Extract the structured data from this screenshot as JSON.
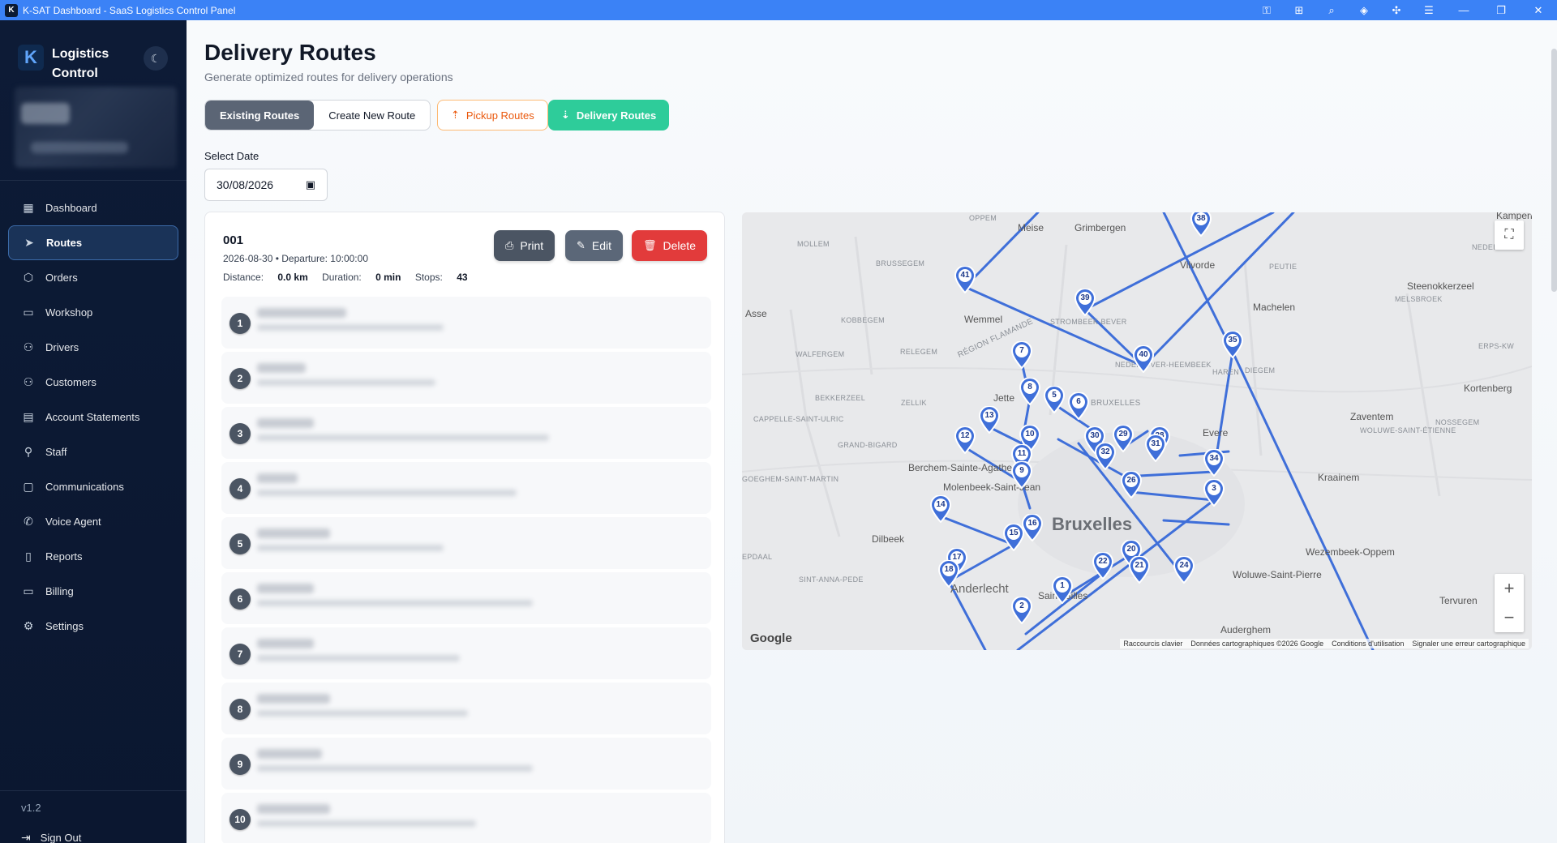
{
  "window": {
    "title": "K-SAT Dashboard - SaaS Logistics Control Panel",
    "logo_letter": "K"
  },
  "brand": {
    "name": "Logistics Control",
    "logo_letter": "K"
  },
  "nav": {
    "items": [
      {
        "label": "Dashboard",
        "icon": "grid-icon"
      },
      {
        "label": "Routes",
        "icon": "navigation-icon",
        "active": true
      },
      {
        "label": "Orders",
        "icon": "box-icon"
      },
      {
        "label": "Workshop",
        "icon": "briefcase-icon"
      },
      {
        "label": "Drivers",
        "icon": "users-icon"
      },
      {
        "label": "Customers",
        "icon": "users-icon"
      },
      {
        "label": "Account Statements",
        "icon": "file-text-icon"
      },
      {
        "label": "Staff",
        "icon": "user-key-icon"
      },
      {
        "label": "Communications",
        "icon": "message-square-icon"
      },
      {
        "label": "Voice Agent",
        "icon": "phone-icon"
      },
      {
        "label": "Reports",
        "icon": "file-icon"
      },
      {
        "label": "Billing",
        "icon": "credit-card-icon"
      },
      {
        "label": "Settings",
        "icon": "gear-icon"
      }
    ]
  },
  "version": "v1.2",
  "signout_label": "Sign Out",
  "page": {
    "title": "Delivery Routes",
    "subtitle": "Generate optimized routes for delivery operations"
  },
  "tabs": {
    "existing": "Existing Routes",
    "create": "Create New Route"
  },
  "buttons": {
    "pickup": "Pickup Routes",
    "delivery": "Delivery Routes"
  },
  "date": {
    "label": "Select Date",
    "value": "30/08/2026"
  },
  "route": {
    "name": "001",
    "meta": "2026-08-30 • Departure: 10:00:00",
    "distance_label": "Distance:",
    "distance_value": "0.0 km",
    "duration_label": "Duration:",
    "duration_value": "0 min",
    "stops_label": "Stops:",
    "stops_value": "43",
    "actions": {
      "print": "Print",
      "edit": "Edit",
      "delete": "Delete"
    },
    "stop_numbers": [
      "1",
      "2",
      "3",
      "4",
      "5",
      "6",
      "7",
      "8",
      "9",
      "10"
    ]
  },
  "map": {
    "labels": {
      "bruxelles": "Bruxelles",
      "grimbergen": "Grimbergen",
      "vilvorde": "Vilvorde",
      "machelen": "Machelen",
      "steenokkerzeel": "Steenokkerzeel",
      "kortenberg": "Kortenberg",
      "zaventem": "Zaventem",
      "kraainem": "Kraainem",
      "evere": "Evere",
      "dilbeek": "Dilbeek",
      "asse": "Asse",
      "wemmel": "Wemmel",
      "jette": "Jette",
      "berchem": "Berchem-Sainte-Agathe",
      "molenbeek": "Molenbeek-Saint-Jean",
      "anderlecht": "Anderlecht",
      "saint_gilles": "Saint-Gilles",
      "auderghem": "Auderghem",
      "tervuren": "Tervuren",
      "wezembeek": "Wezembeek-Oppem",
      "woluwe_sp": "Woluwe-Saint-Pierre",
      "meise": "Meise",
      "oppem": "OPPEM",
      "mollem": "MOLLEM",
      "brussegem": "BRUSSEGEM",
      "kobbegem": "KOBBEGEM",
      "walfergem": "WALFERGEM",
      "relegem": "RELEGEM",
      "bekkerzeel": "BEKKERZEEL",
      "zellik": "ZELLIK",
      "cappelle": "CAPPELLE-SAINT-ULRIC",
      "grand_bigard": "GRAND-BIGARD",
      "goeghem": "GOEGHEM-SAINT-MARTIN",
      "sint_anna": "SINT-ANNA-PEDE",
      "epdaal": "EPDAAL",
      "region": "RÉGION FLAMANDE",
      "bruxelles_small": "BRUXELLES",
      "strombeek": "STROMBEEK-BEVER",
      "neder": "NEDER-OVER-HEEMBEEK",
      "haren": "HAREN",
      "diegem": "DIEGEM",
      "peutie": "PEUTIE",
      "melsbroek": "MELSBROEK",
      "nederok": "NEDEROK",
      "erps": "ERPS-KW",
      "nossegem": "NOSSEGEM",
      "woluwe_se": "WOLUWE-SAINT-ÉTIENNE",
      "kampenh": "Kampenh"
    },
    "google": "Google",
    "footer": [
      "Raccourcis clavier",
      "Données cartographiques ©2026 Google",
      "Conditions d'utilisation",
      "Signaler une erreur cartographique"
    ],
    "markers": [
      "38",
      "41",
      "39",
      "40",
      "35",
      "7",
      "8",
      "5",
      "6",
      "13",
      "10",
      "12",
      "11",
      "9",
      "30",
      "29",
      "28",
      "31",
      "32",
      "34",
      "26",
      "3",
      "14",
      "15",
      "16",
      "20",
      "21",
      "22",
      "24",
      "17",
      "18",
      "1",
      "2"
    ]
  },
  "colors": {
    "accent": "#3b82f6",
    "route_line": "#3f6fd9",
    "delivery": "#2ecc9a",
    "pickup": "#ea580c",
    "delete": "#e23b3b"
  }
}
